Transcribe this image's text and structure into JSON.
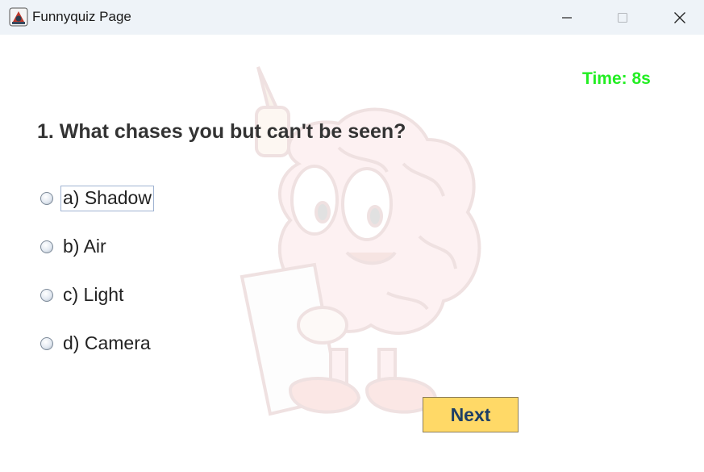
{
  "window": {
    "title": "Funnyquiz Page",
    "icons": {
      "app": "java-app-icon",
      "minimize": "minimize-icon",
      "maximize": "maximize-icon",
      "close": "close-icon"
    }
  },
  "quiz": {
    "timer": "Time: 8s",
    "timer_color": "#22ee22",
    "question": "1. What chases you but can't be seen?",
    "options": [
      {
        "label": "a) Shadow",
        "selected": false,
        "focused": true
      },
      {
        "label": "b) Air",
        "selected": false,
        "focused": false
      },
      {
        "label": "c) Light",
        "selected": false,
        "focused": false
      },
      {
        "label": "d) Camera",
        "selected": false,
        "focused": false
      }
    ],
    "next_label": "Next",
    "next_color": "#ffd967",
    "background_image": "brain-mascot-watermark"
  }
}
